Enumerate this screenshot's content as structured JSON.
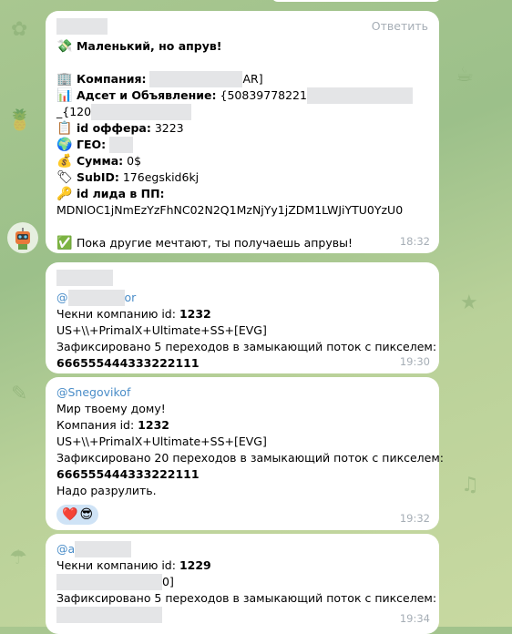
{
  "messages": [
    {
      "reply_label": "Ответить",
      "lines": [
        {
          "icon": "💸",
          "bold": "Маленький, но апрув!",
          "text": ""
        },
        {
          "icon": "🏢",
          "bold": "Компания:",
          "text": "AR]"
        },
        {
          "icon": "📊",
          "bold": "Адсет и Объявление:",
          "text": "{50839778221"
        },
        {
          "icon": "",
          "bold": "",
          "text": "_{120"
        },
        {
          "icon": "📋",
          "bold": "id оффера:",
          "text": "3223"
        },
        {
          "icon": "🌍",
          "bold": "ГЕО:",
          "text": ""
        },
        {
          "icon": "💰",
          "bold": "Сумма:",
          "text": "0$"
        },
        {
          "icon": "🏷",
          "bold": "SubID:",
          "text": "176egskid6kj"
        },
        {
          "icon": "🔑",
          "bold": "id лида в ПП:",
          "text": ""
        },
        {
          "icon": "",
          "bold": "",
          "text": "MDNlOC1jNmEzYzFhNC02N2Q1MzNjYy1jZDM1LWJiYTU0YzU0"
        },
        {
          "icon": "✅",
          "bold": "",
          "text": "Пока другие мечтают, ты получаешь апрувы!"
        }
      ],
      "time": "18:32"
    },
    {
      "sender": "or",
      "lines": [
        "Чекни компанию id: ",
        "US+\\\\+PrimalX+Ultimate+SS+[EVG]",
        "Зафиксировано 5 переходов в замыкающий поток с пикселем:",
        "666555444333222111"
      ],
      "id_value": "1232",
      "time": "19:30"
    },
    {
      "sender": "@Snegovikof",
      "lines": [
        "Мир твоему дому!",
        "Компания id: ",
        "US+\\\\+PrimalX+Ultimate+SS+[EVG]",
        "Зафиксировано 20 переходов в замыкающий поток с пикселем:",
        "666555444333222111",
        "Надо разрулить."
      ],
      "id_value": "1232",
      "reactions": [
        "❤️",
        "😎"
      ],
      "time": "19:32"
    },
    {
      "sender": "@a",
      "lines": [
        "Чекни компанию id: ",
        "0]",
        "Зафиксировано 5 переходов в замыкающий поток с пикселем:"
      ],
      "id_value": "1229",
      "time": "19:34"
    }
  ]
}
